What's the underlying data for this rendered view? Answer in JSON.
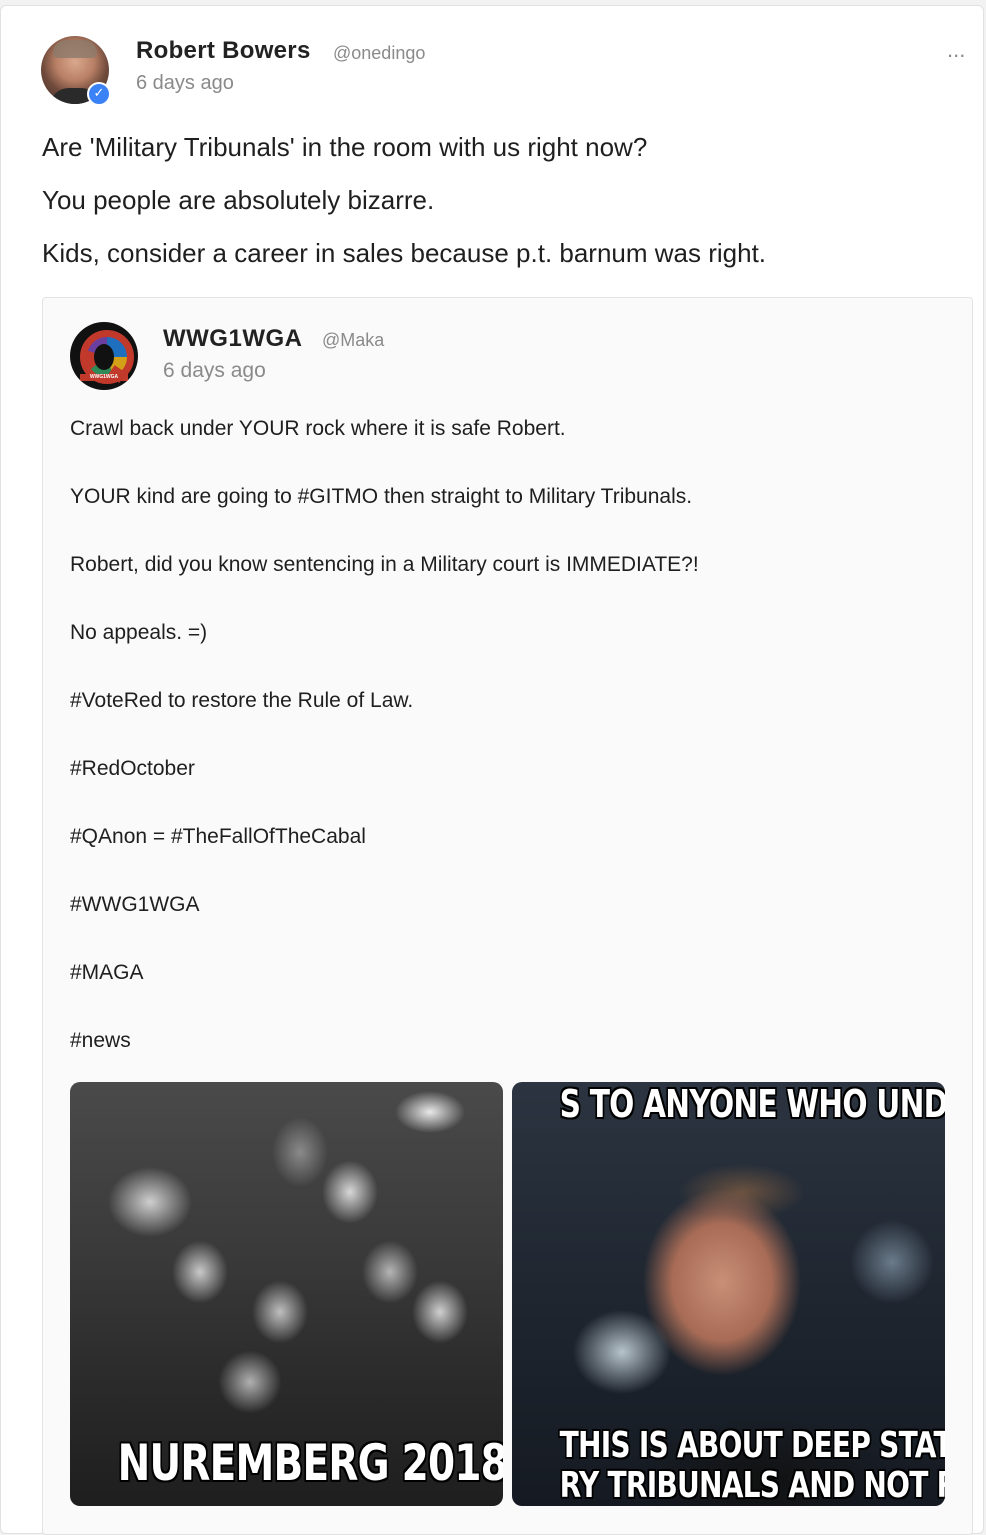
{
  "post": {
    "author": {
      "name": "Robert Bowers",
      "handle": "@onedingo",
      "verified": true
    },
    "time": "6 days ago",
    "menu_icon": "more-horizontal-icon",
    "menu_label": "...",
    "verified_glyph": "✓",
    "body_lines": [
      "Are 'Military Tribunals' in the room with us right now?",
      "You people are absolutely bizarre.",
      "Kids, consider a career in sales because p.t. barnum was right."
    ]
  },
  "quoted_post": {
    "author": {
      "name": "WWG1WGA",
      "handle": "@Maka",
      "avatar_text": "WWG1WGA"
    },
    "time": "6 days ago",
    "body_lines": [
      "Crawl back under YOUR rock where it is safe Robert.",
      "YOUR kind are going to #GITMO then straight to Military Tribunals.",
      "Robert, did you know sentencing in a Military court is IMMEDIATE?!",
      "No appeals. =)",
      "#VoteRed to restore the Rule of Law.",
      "#RedOctober",
      "#QAnon = #TheFallOfTheCabal",
      "#WWG1WGA",
      "#MAGA",
      "#news"
    ],
    "images": [
      {
        "caption": "NUREMBERG 2018"
      },
      {
        "top_text": "S TO ANYONE WHO UNDERS",
        "bottom_text_1": "THIS IS ABOUT DEEP STATE",
        "bottom_text_2": "RY TRIBUNALS AND NOT ROE V"
      }
    ]
  },
  "colors": {
    "text_primary": "#1f1f1f",
    "text_muted": "#8a8a8a",
    "verified_blue": "#3b82f6",
    "card_border": "#e3e3e3"
  }
}
